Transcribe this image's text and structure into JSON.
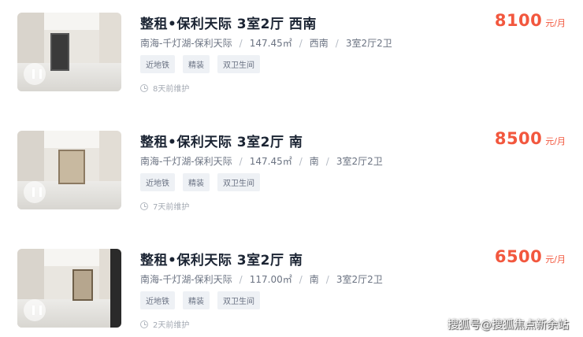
{
  "listings": [
    {
      "title": "整租•保利天际 3室2厅 西南",
      "location": "南海-千灯湖-保利天际",
      "area": "147.45㎡",
      "orientation": "西南",
      "layout": "3室2厅2卫",
      "tags": [
        "近地铁",
        "精装",
        "双卫生间"
      ],
      "time": "8天前维护",
      "price": "8100",
      "price_unit": "元/月"
    },
    {
      "title": "整租•保利天际 3室2厅 南",
      "location": "南海-千灯湖-保利天际",
      "area": "147.45㎡",
      "orientation": "南",
      "layout": "3室2厅2卫",
      "tags": [
        "近地铁",
        "精装",
        "双卫生间"
      ],
      "time": "7天前维护",
      "price": "8500",
      "price_unit": "元/月"
    },
    {
      "title": "整租•保利天际 3室2厅 南",
      "location": "南海-千灯湖-保利天际",
      "area": "117.00㎡",
      "orientation": "南",
      "layout": "3室2厅2卫",
      "tags": [
        "近地铁",
        "精装",
        "双卫生间"
      ],
      "time": "2天前维护",
      "price": "6500",
      "price_unit": "元/月"
    }
  ],
  "meta_separator": "/",
  "watermark": "搜狐号@搜狐焦点新余站",
  "colors": {
    "price": "#f2573e",
    "title": "#1b2433",
    "tag_bg": "#eef1f5"
  },
  "icons": {
    "time": "clock-icon",
    "media": "play-icon"
  }
}
